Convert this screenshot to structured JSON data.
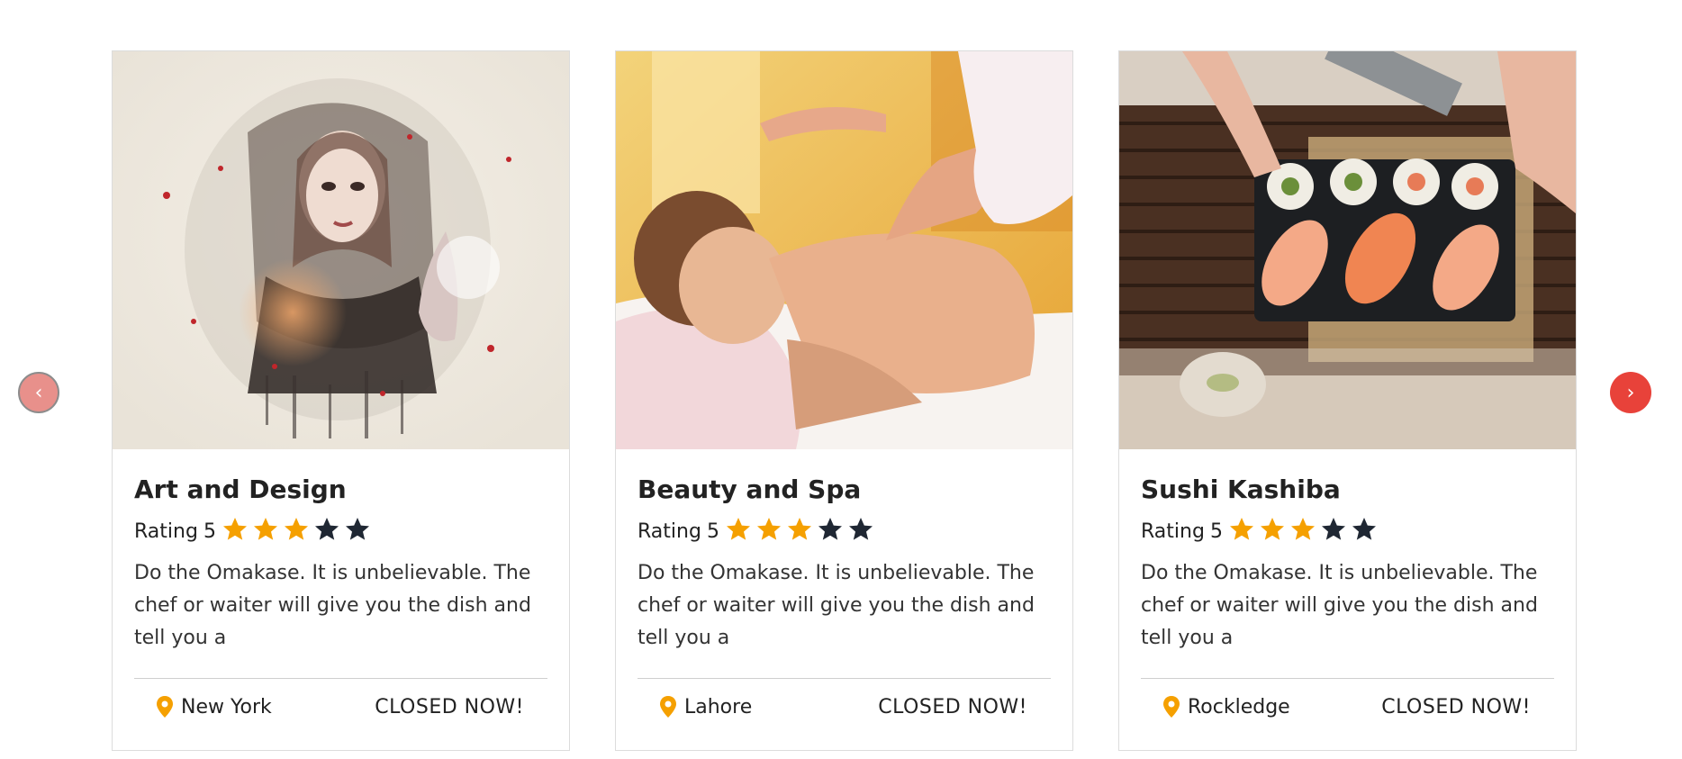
{
  "nav": {
    "prev_glyph": "‹",
    "next_glyph": "›",
    "prev_color": "#e8908b",
    "next_color": "#e8423a"
  },
  "colors": {
    "star_filled": "#f5a000",
    "star_empty": "#1f2733",
    "pin": "#f5a000"
  },
  "cards": [
    {
      "title": "Art and Design",
      "rating_label": "Rating",
      "rating_value": "5",
      "stars_filled": 3,
      "stars_total": 5,
      "description": "Do the Omakase. It is unbelievable. The chef or waiter will give you the dish and tell you a",
      "location": "New York",
      "status": "CLOSED NOW!",
      "image": "watercolor-portrait-photo"
    },
    {
      "title": "Beauty and Spa",
      "rating_label": "Rating",
      "rating_value": "5",
      "stars_filled": 3,
      "stars_total": 5,
      "description": "Do the Omakase. It is unbelievable. The chef or waiter will give you the dish and tell you a",
      "location": "Lahore",
      "status": "CLOSED NOW!",
      "image": "spa-massage-photo"
    },
    {
      "title": "Sushi Kashiba",
      "rating_label": "Rating",
      "rating_value": "5",
      "stars_filled": 3,
      "stars_total": 5,
      "description": "Do the Omakase. It is unbelievable. The chef or waiter will give you the dish and tell you a",
      "location": "Rockledge",
      "status": "CLOSED NOW!",
      "image": "sushi-platter-photo"
    }
  ]
}
